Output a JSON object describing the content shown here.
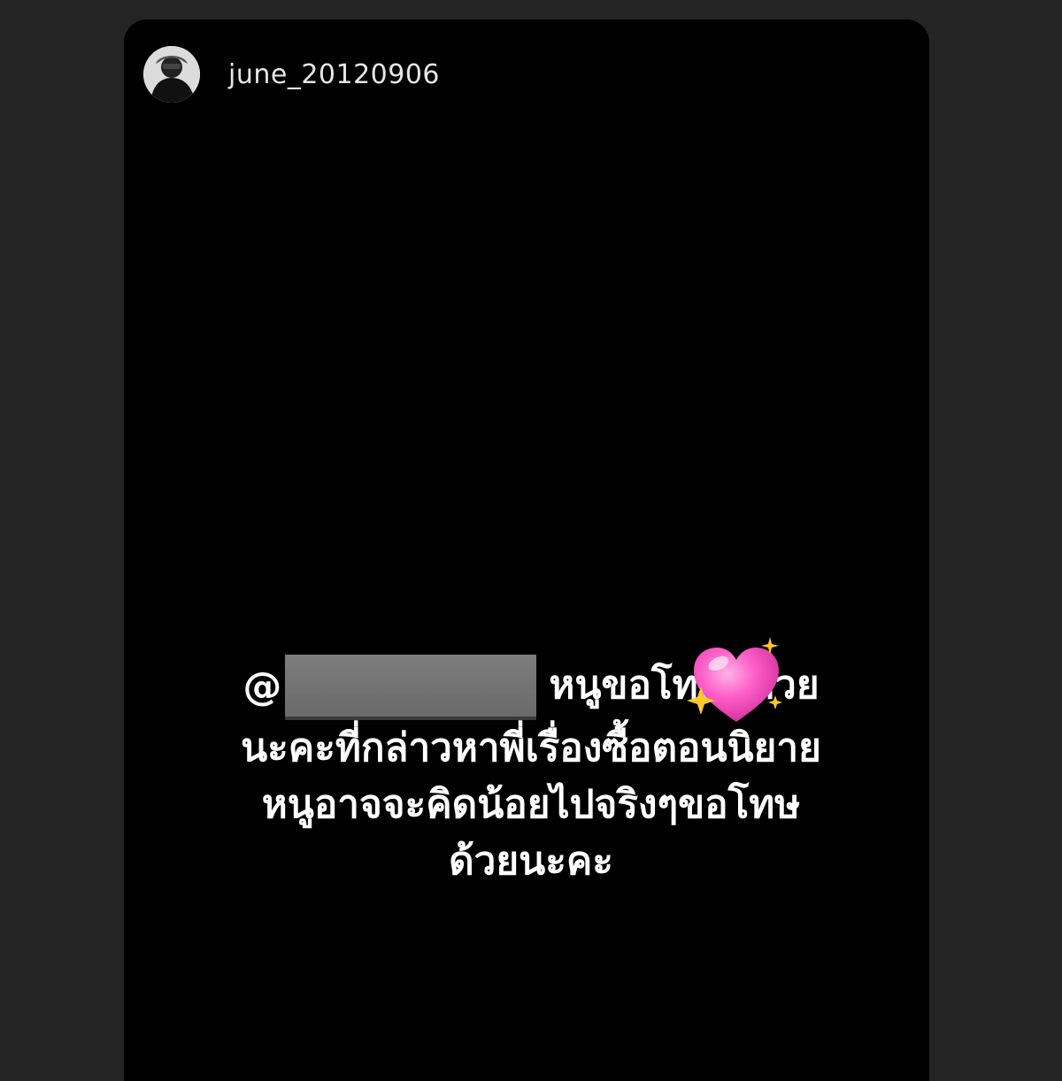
{
  "story": {
    "username": "june_20120906",
    "caption": {
      "mention_prefix": "@",
      "line1_after_mention": "หนูขอโทษพี่ด้วย",
      "line2": "นะคะที่กล่าวหาพี่เรื่องซื้อตอนนิยาย",
      "line3": "หนูอาจจะคิดน้อยไปจริงๆขอโทษ",
      "line4": "ด้วยนะคะ"
    },
    "sticker": "sparkling-heart",
    "colors": {
      "background": "#000000",
      "page": "#242424",
      "text": "#ffffff",
      "redaction": "#727272",
      "heart": "#ff5fc8",
      "sparkle": "#ffc928"
    }
  }
}
